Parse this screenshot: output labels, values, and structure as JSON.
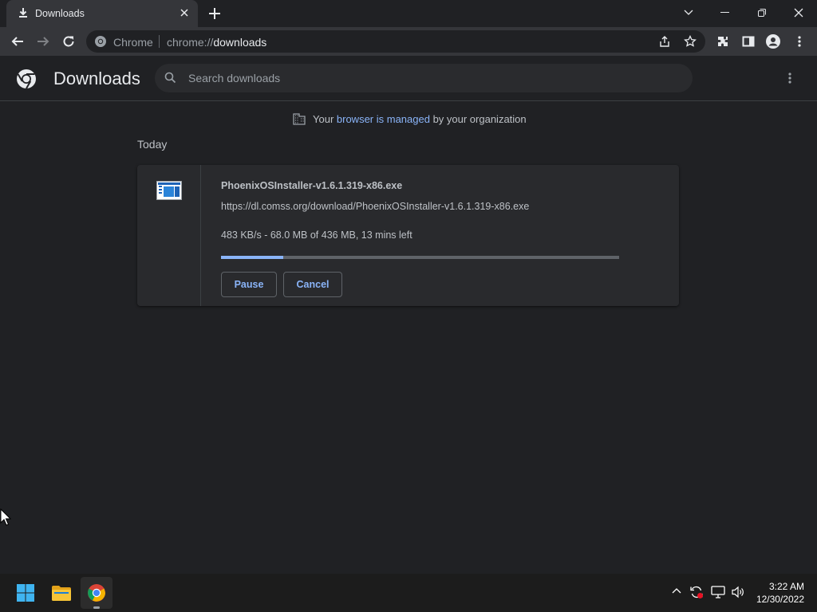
{
  "tab": {
    "title": "Downloads",
    "icon": "download-icon"
  },
  "omnibox": {
    "site_label": "Chrome",
    "url_prefix": "chrome://",
    "url_path": "downloads"
  },
  "page": {
    "title": "Downloads",
    "search_placeholder": "Search downloads",
    "managed_prefix": "Your ",
    "managed_link": "browser is managed",
    "managed_suffix": " by your organization",
    "section_label": "Today"
  },
  "download": {
    "file_name": "PhoenixOSInstaller-v1.6.1.319-x86.exe",
    "url": "https://dl.comss.org/download/PhoenixOSInstaller-v1.6.1.319-x86.exe",
    "status": "483 KB/s - 68.0 MB of 436 MB, 13 mins left",
    "progress_fraction": 0.156,
    "pause_label": "Pause",
    "cancel_label": "Cancel"
  },
  "taskbar": {
    "time": "3:22 AM",
    "date": "12/30/2022"
  },
  "colors": {
    "accent": "#8ab4f8",
    "background": "#202124",
    "card": "#292a2d"
  }
}
